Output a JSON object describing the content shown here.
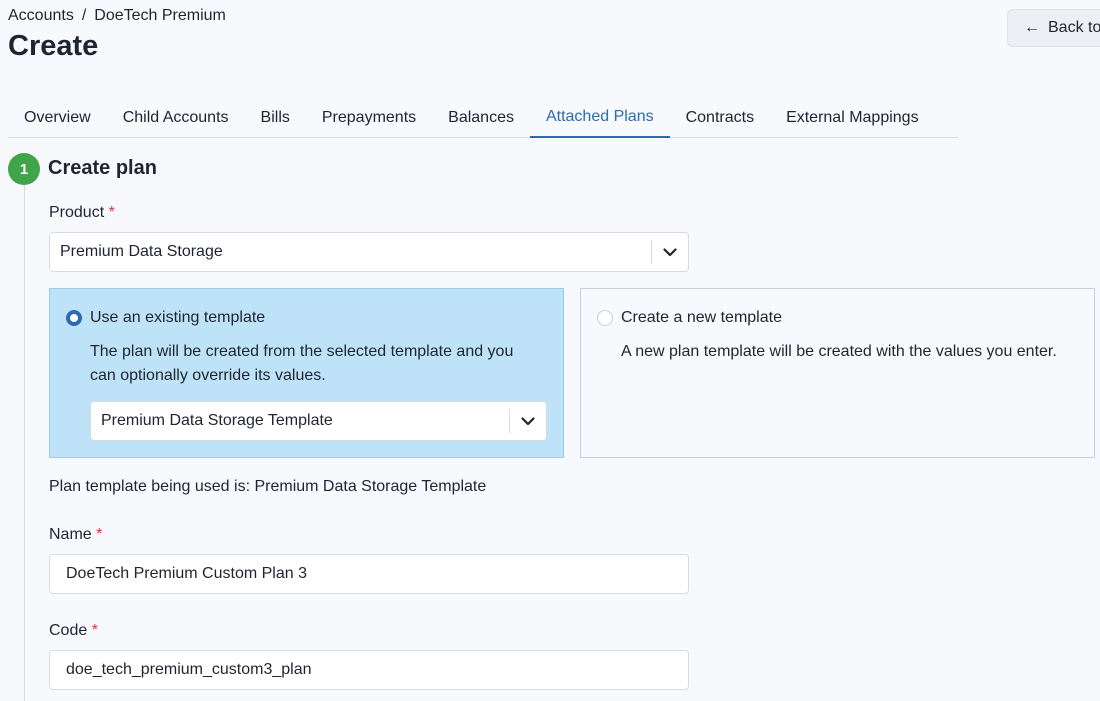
{
  "breadcrumb": {
    "root": "Accounts",
    "separator": "/",
    "current": "DoeTech Premium"
  },
  "page": {
    "title": "Create",
    "back_label": "Back to"
  },
  "tabs": [
    {
      "label": "Overview"
    },
    {
      "label": "Child Accounts"
    },
    {
      "label": "Bills"
    },
    {
      "label": "Prepayments"
    },
    {
      "label": "Balances"
    },
    {
      "label": "Attached Plans"
    },
    {
      "label": "Contracts"
    },
    {
      "label": "External Mappings"
    }
  ],
  "active_tab": "Attached Plans",
  "step": {
    "number": "1",
    "title": "Create plan"
  },
  "form": {
    "required_marker": "*",
    "product": {
      "label": "Product",
      "value": "Premium Data Storage"
    },
    "template_options": {
      "existing": {
        "title": "Use an existing template",
        "description_line1": "The plan will be created from the selected template and you",
        "description_line2": "can optionally override its values.",
        "selected_template": "Premium Data Storage Template"
      },
      "new": {
        "title": "Create a new template",
        "description": "A new plan template will be created with the values you enter."
      }
    },
    "template_info": "Plan template being used is: Premium Data Storage Template",
    "name": {
      "label": "Name",
      "value": "DoeTech Premium Custom Plan 3"
    },
    "code": {
      "label": "Code",
      "value": "doe_tech_premium_custom3_plan"
    }
  },
  "colors": {
    "accent": "#2b6cb0",
    "step_badge": "#3fa548",
    "selected_card": "#bee3f8",
    "required": "#d9363e"
  },
  "icons": {
    "back": "arrow-left-icon",
    "dropdown": "chevron-down-icon"
  }
}
